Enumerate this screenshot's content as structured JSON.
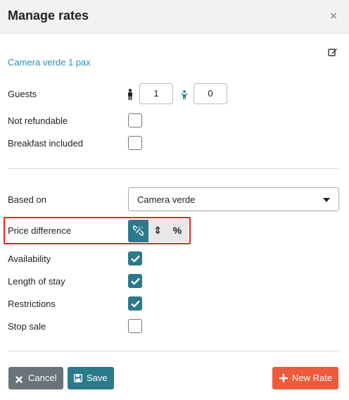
{
  "header": {
    "title": "Manage rates",
    "close": "×"
  },
  "room": {
    "name": "Camera verde 1 pax"
  },
  "fields": {
    "guests_label": "Guests",
    "adults": "1",
    "children": "0",
    "not_refundable_label": "Not refundable",
    "breakfast_label": "Breakfast included",
    "based_on_label": "Based on",
    "based_on_value": "Camera verde",
    "price_difference_label": "Price difference",
    "availability_label": "Availability",
    "length_of_stay_label": "Length of stay",
    "restrictions_label": "Restrictions",
    "stop_sale_label": "Stop sale"
  },
  "toggles": {
    "arrows": "⇕",
    "percent": "%"
  },
  "buttons": {
    "cancel": "Cancel",
    "save": "Save",
    "new_rate": "New Rate"
  },
  "colors": {
    "accent": "#2b7a8c",
    "link": "#2a8fb5",
    "danger": "#ef5a3a",
    "highlight": "#e4262a"
  }
}
